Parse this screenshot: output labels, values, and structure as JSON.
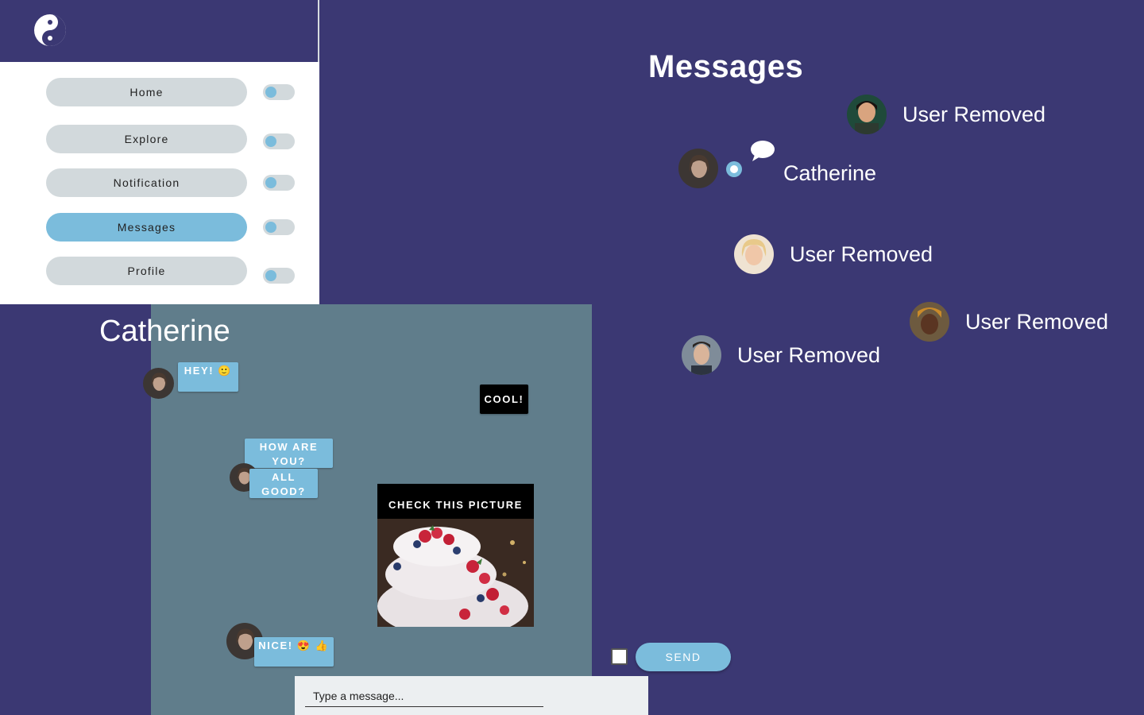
{
  "sidebar": {
    "logo_icon": "yin-yang-icon",
    "items": [
      {
        "label": "Home",
        "active": false
      },
      {
        "label": "Explore",
        "active": false
      },
      {
        "label": "Notification",
        "active": false
      },
      {
        "label": "Messages",
        "active": true
      },
      {
        "label": "Profile",
        "active": false
      }
    ]
  },
  "messages": {
    "title": "Messages",
    "contacts": [
      {
        "name": "User Removed"
      },
      {
        "name": "Catherine"
      },
      {
        "name": "User Removed"
      },
      {
        "name": "User Removed"
      },
      {
        "name": "User Removed"
      }
    ],
    "chat_icon": "speech-bubble-icon"
  },
  "chat": {
    "name": "Catherine",
    "messages": [
      {
        "text": "HEY! 🙂"
      },
      {
        "text": "COOL!"
      },
      {
        "text": "HOW ARE YOU?"
      },
      {
        "text": "ALL GOOD?"
      },
      {
        "text": "CHECK THIS PICTURE"
      },
      {
        "text": "NICE! 😍 👍"
      }
    ]
  },
  "composer": {
    "placeholder": "Type a message...",
    "send_label": "SEND"
  },
  "colors": {
    "background": "#3b3873",
    "accent": "#7bbcdc",
    "chat_panel": "#607d8b",
    "nav_idle": "#d2d9dc"
  }
}
